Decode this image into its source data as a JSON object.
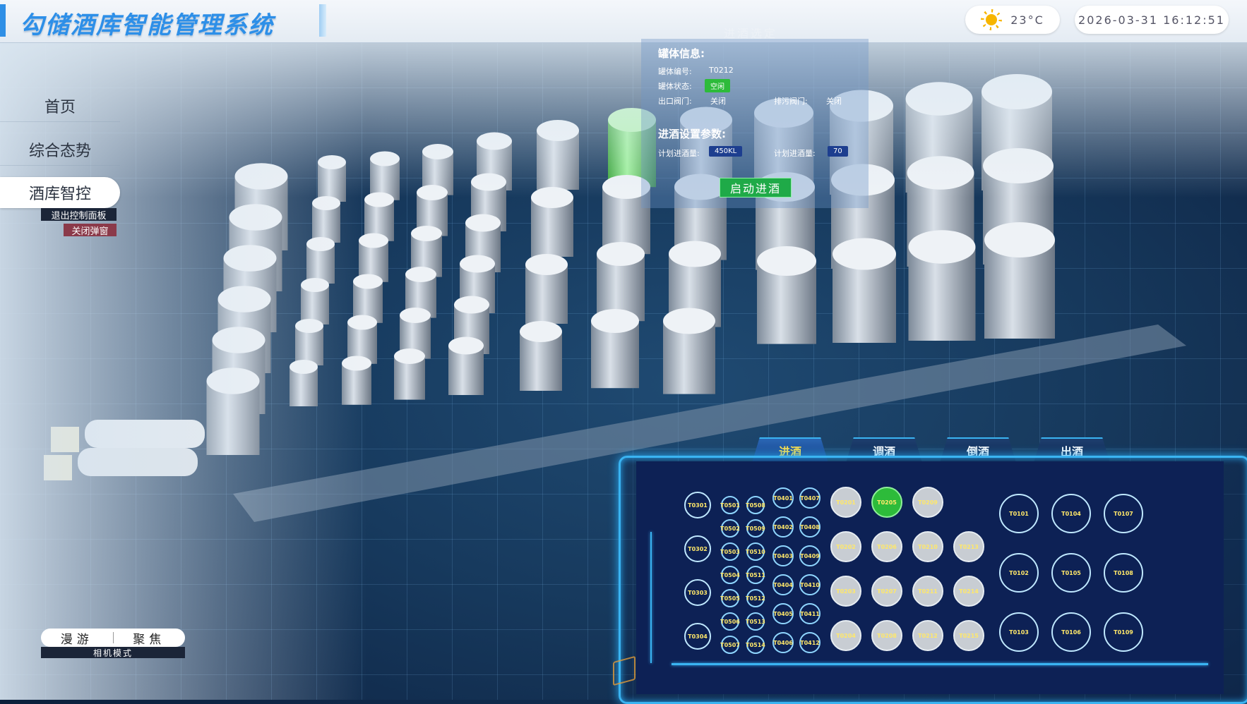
{
  "header": {
    "title": "勾储酒库智能管理系统",
    "temperature": "23°C",
    "datetime": "2026-03-31 16:12:51"
  },
  "nav": {
    "items": [
      "首页",
      "综合态势",
      "酒库智控"
    ],
    "active": "酒库智控",
    "exit_panel": "退出控制面板",
    "close_popup": "关闭弹窗"
  },
  "camera": {
    "roam": "漫游",
    "focus": "聚焦",
    "mode_label": "相机模式"
  },
  "info": {
    "title": "进酒选定",
    "tank_section": "罐体信息:",
    "tank_no_label": "罐体编号:",
    "tank_no": "T0212",
    "tank_status_label": "罐体状态:",
    "tank_status": "空闲",
    "outlet_valve_label": "出口阀门:",
    "outlet_valve": "关闭",
    "drain_valve_label": "排污阀门:",
    "drain_valve": "关闭",
    "params_section": "进酒设置参数:",
    "plan_volume_label": "计划进酒量:",
    "plan_volume": "450KL",
    "plan_volume2_label": "计划进酒量:",
    "plan_volume2": "70",
    "start_button": "启动进酒"
  },
  "tabs": [
    "进酒",
    "调酒",
    "倒酒",
    "出酒"
  ],
  "active_tab": "进酒",
  "tanks": {
    "col1": [
      "T0301",
      "T0302",
      "T0303",
      "T0304"
    ],
    "col2": [
      "T0501",
      "T0502",
      "T0503",
      "T0504",
      "T0505",
      "T0506",
      "T0507"
    ],
    "col3": [
      "T0508",
      "T0509",
      "T0510",
      "T0511",
      "T0512",
      "T0513",
      "T0514"
    ],
    "col4": [
      "T0401",
      "T0402",
      "T0403",
      "T0404",
      "T0405",
      "T0406"
    ],
    "col5": [
      "T0407",
      "T0408",
      "T0409",
      "T0410",
      "T0411",
      "T0412"
    ],
    "col6": [
      "T0201",
      "T0202",
      "T0203",
      "T0204"
    ],
    "col7": [
      "T0205",
      "T0206",
      "T0207",
      "T0208"
    ],
    "col8": [
      "T0209",
      "T0210",
      "T0211",
      "T0212"
    ],
    "col9": [
      "T0213",
      "T0214",
      "T0215"
    ],
    "col10": [
      "T0101",
      "T0102",
      "T0103"
    ],
    "col11": [
      "T0104",
      "T0105",
      "T0106"
    ],
    "col12": [
      "T0107",
      "T0108",
      "T0109"
    ],
    "selected": "T0205"
  },
  "colors": {
    "accent": "#2d8fe8",
    "status_green": "#2dbb3a",
    "panel_bg": "#0d2155",
    "tab_active": "#ffe04a"
  }
}
